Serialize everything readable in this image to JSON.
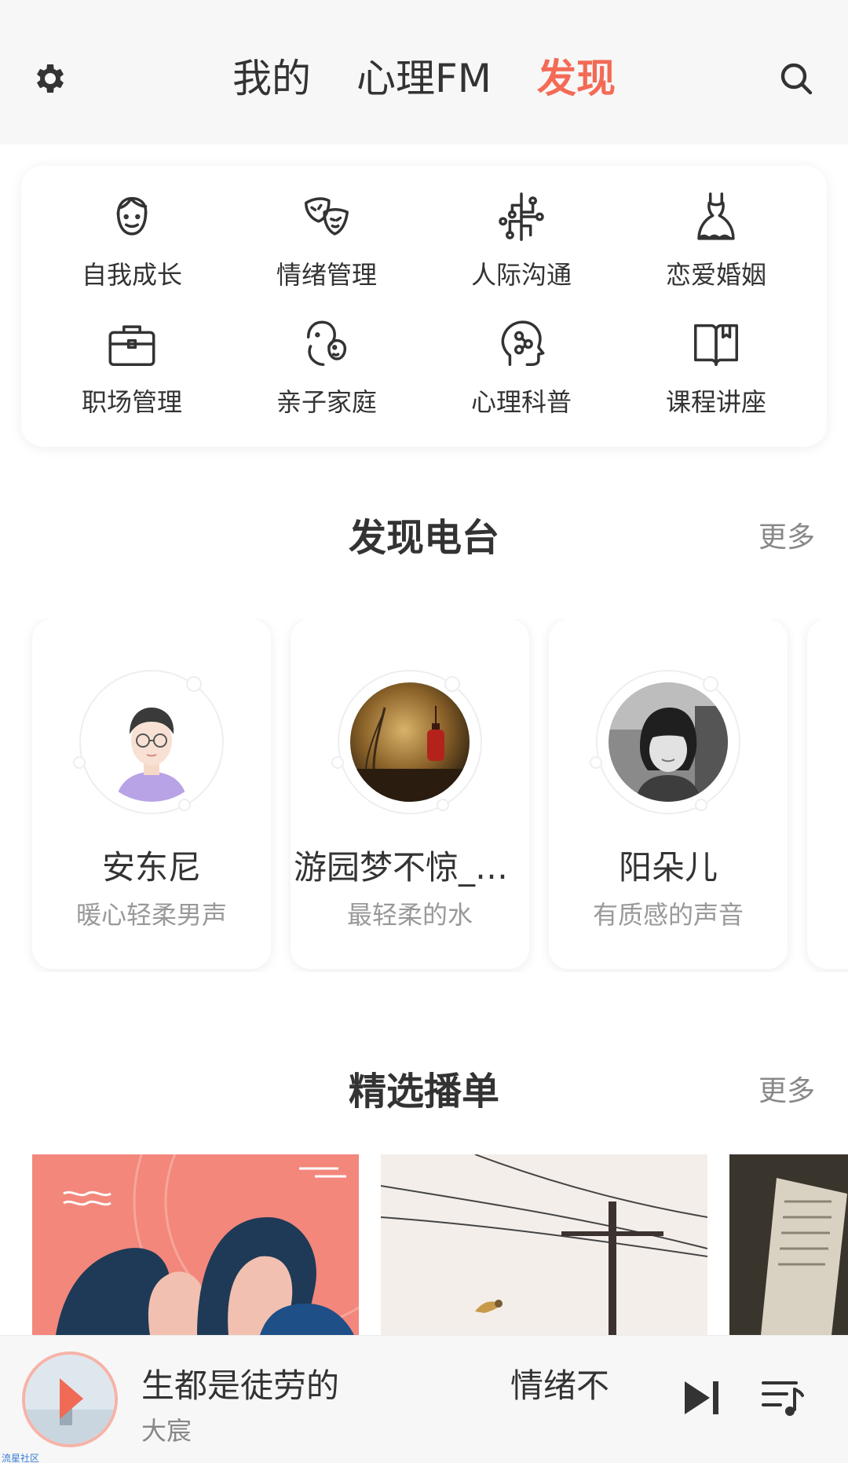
{
  "header": {
    "tabs": [
      {
        "label": "我的",
        "active": false
      },
      {
        "label": "心理FM",
        "active": false
      },
      {
        "label": "发现",
        "active": true
      }
    ],
    "left_icon": "gear-icon",
    "right_icon": "search-icon",
    "accent_color": "#f46a55"
  },
  "categories": [
    {
      "label": "自我成长",
      "icon": "face-icon"
    },
    {
      "label": "情绪管理",
      "icon": "masks-icon"
    },
    {
      "label": "人际沟通",
      "icon": "network-icon"
    },
    {
      "label": "恋爱婚姻",
      "icon": "dress-icon"
    },
    {
      "label": "职场管理",
      "icon": "briefcase-icon"
    },
    {
      "label": "亲子家庭",
      "icon": "parent-child-icon"
    },
    {
      "label": "心理科普",
      "icon": "head-icon"
    },
    {
      "label": "课程讲座",
      "icon": "book-icon"
    }
  ],
  "radio_section": {
    "title": "发现电台",
    "more": "更多",
    "items": [
      {
        "name": "安东尼",
        "desc": "暖心轻柔男声"
      },
      {
        "name": "游园梦不惊_子...",
        "desc": "最轻柔的水"
      },
      {
        "name": "阳朵儿",
        "desc": "有质感的声音"
      }
    ]
  },
  "playlist_section": {
    "title": "精选播单",
    "more": "更多"
  },
  "player": {
    "title": "生都是徒劳的",
    "title_next": "情绪不",
    "singer": "大宸",
    "next_icon": "skip-next-icon",
    "list_icon": "playlist-icon"
  },
  "watermark": "流星社区"
}
